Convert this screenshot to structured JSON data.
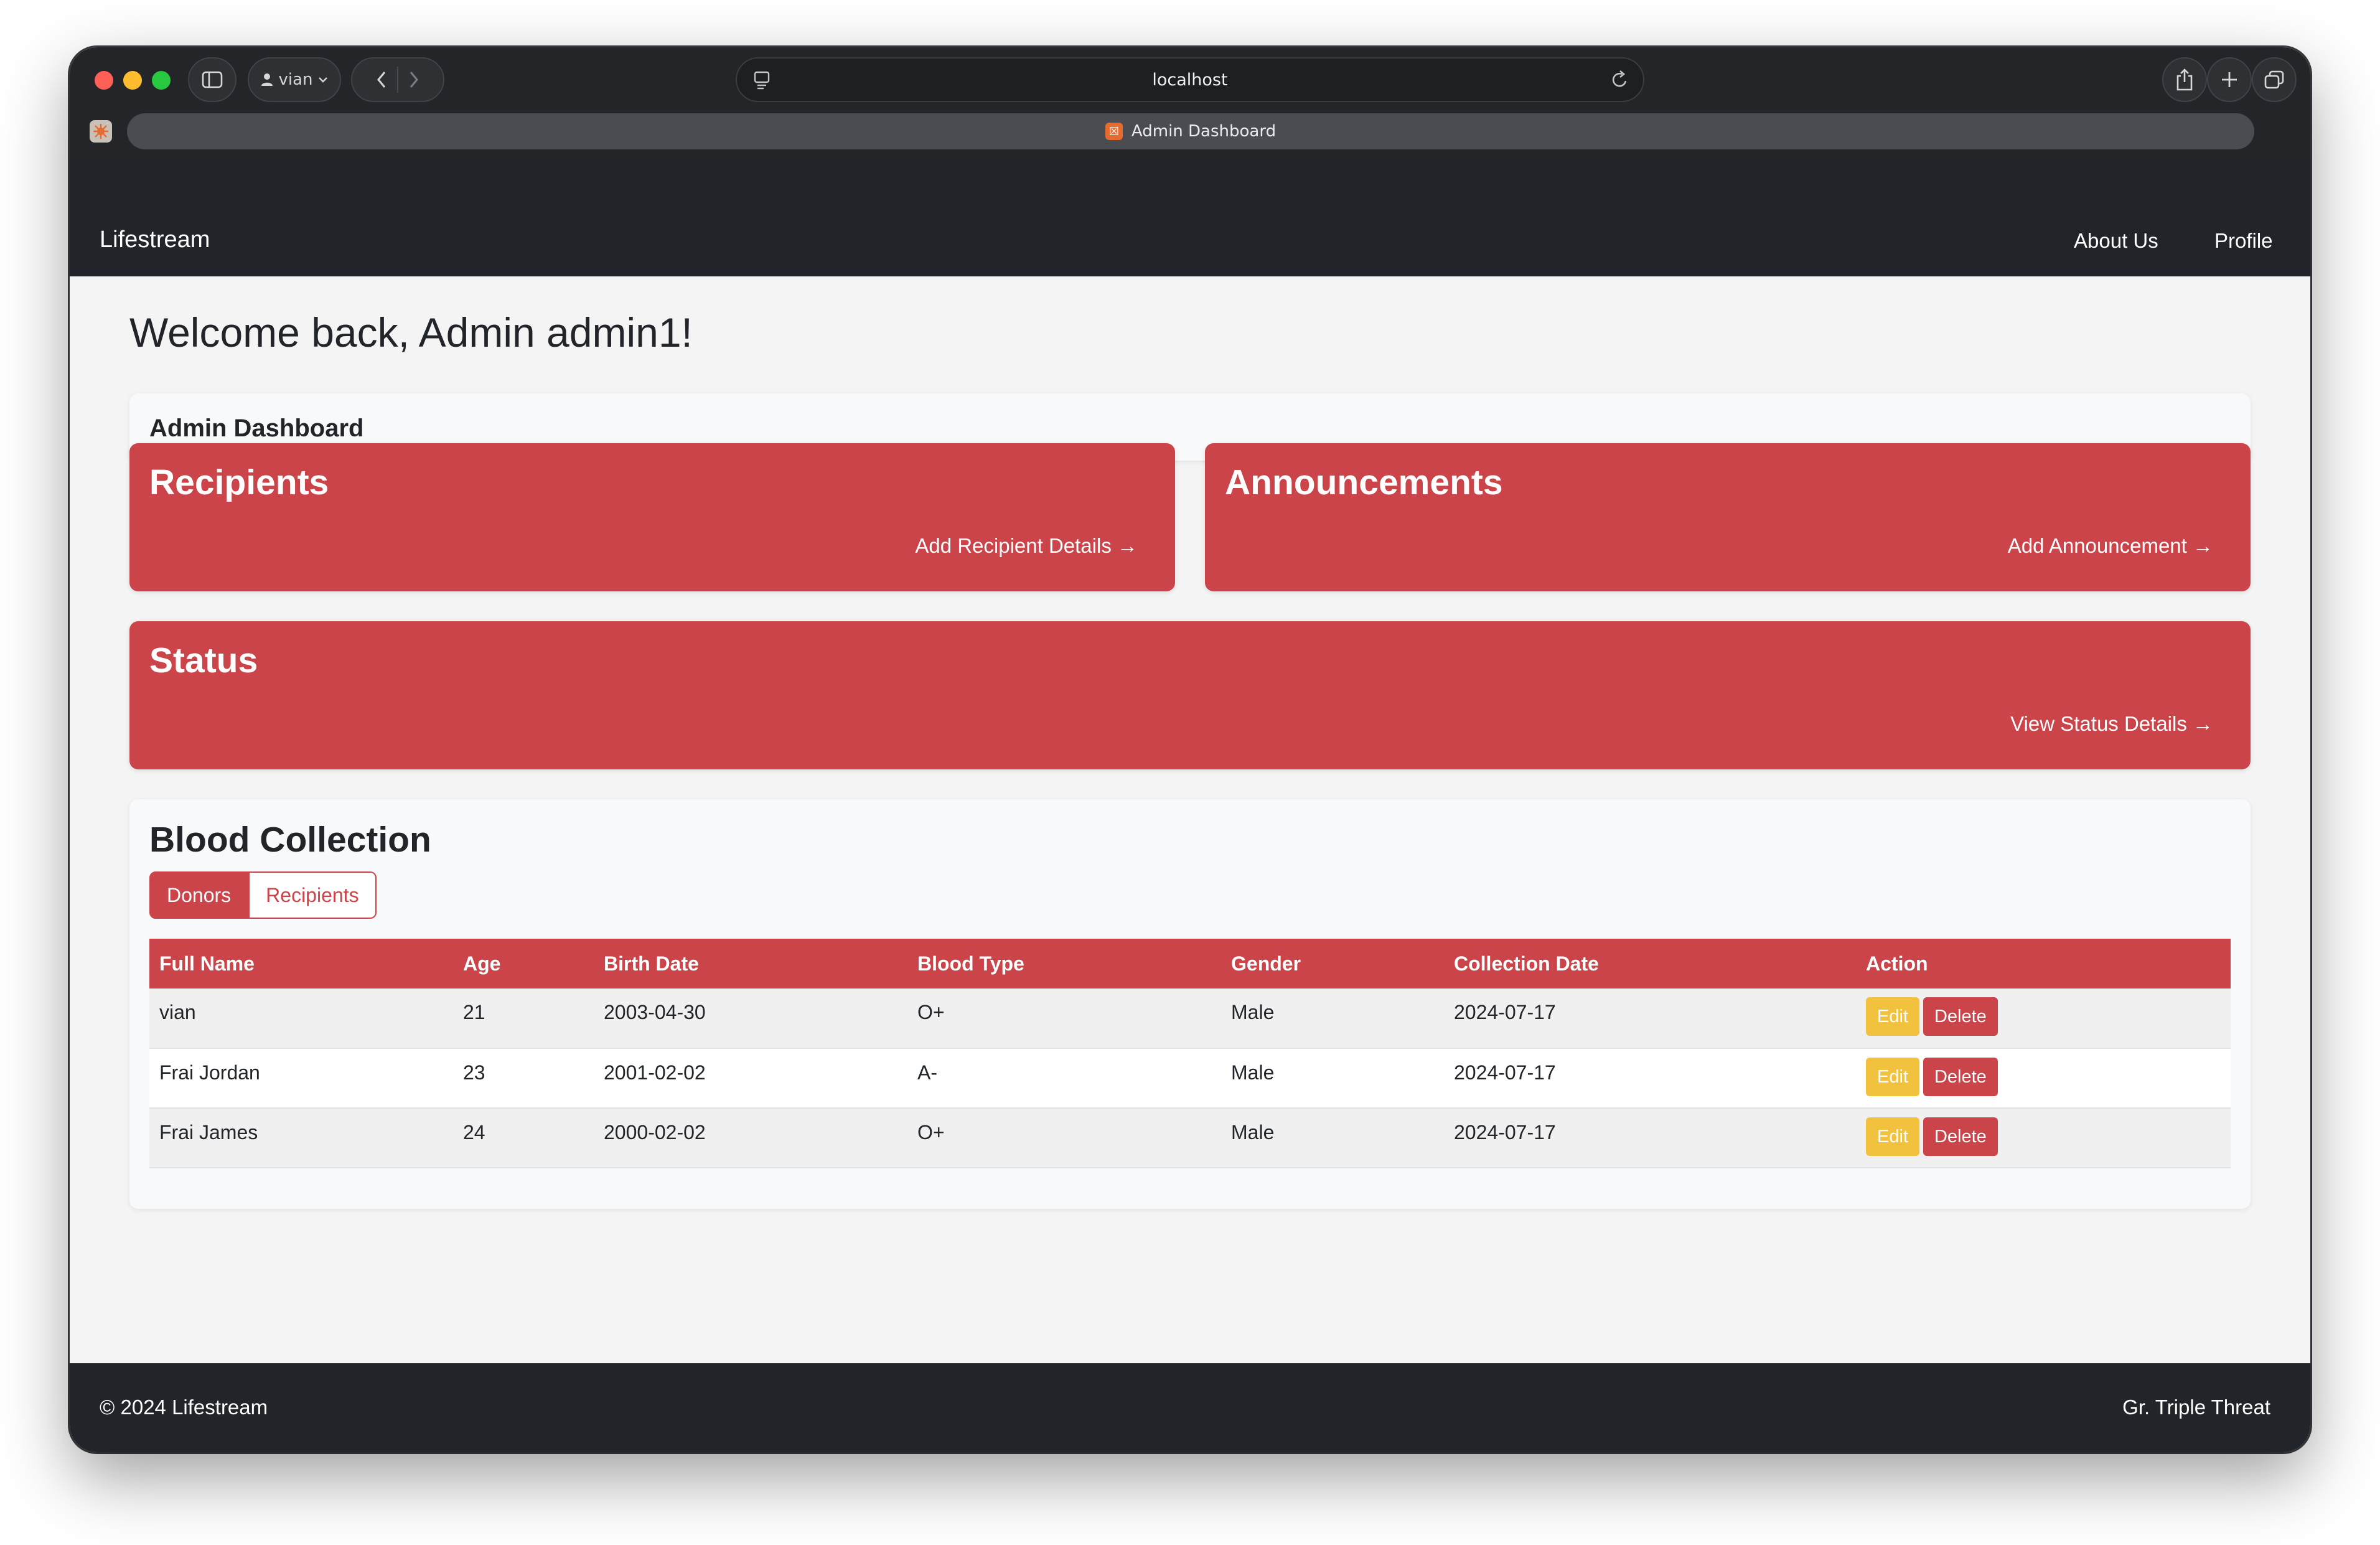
{
  "browser": {
    "profile_name": "vian",
    "address": "localhost",
    "tab_title": "Admin Dashboard"
  },
  "navbar": {
    "brand": "Lifestream",
    "links": [
      "About Us",
      "Profile"
    ]
  },
  "welcome": "Welcome back, Admin admin1!",
  "dashboard_title": "Admin Dashboard",
  "cards": [
    {
      "title": "Recipients",
      "link": "Add Recipient Details →"
    },
    {
      "title": "Announcements",
      "link": "Add Announcement →"
    },
    {
      "title": "Status",
      "link": "View Status Details →"
    }
  ],
  "blood_collection": {
    "title": "Blood Collection",
    "tabs": [
      {
        "label": "Donors",
        "active": true
      },
      {
        "label": "Recipients",
        "active": false
      }
    ],
    "columns": [
      "Full Name",
      "Age",
      "Birth Date",
      "Blood Type",
      "Gender",
      "Collection Date",
      "Action"
    ],
    "rows": [
      {
        "name": "vian",
        "age": "21",
        "birth_date": "2003-04-30",
        "blood_type": "O+",
        "gender": "Male",
        "collection_date": "2024-07-17"
      },
      {
        "name": "Frai Jordan",
        "age": "23",
        "birth_date": "2001-02-02",
        "blood_type": "A-",
        "gender": "Male",
        "collection_date": "2024-07-17"
      },
      {
        "name": "Frai James",
        "age": "24",
        "birth_date": "2000-02-02",
        "blood_type": "O+",
        "gender": "Male",
        "collection_date": "2024-07-17"
      }
    ],
    "actions": {
      "edit": "Edit",
      "delete": "Delete"
    }
  },
  "footer": {
    "copyright": "© 2024 Lifestream",
    "credit": "Gr. Triple Threat"
  },
  "colors": {
    "accent_red": "#cb444a",
    "edit_yellow": "#f2c13d",
    "navbar_dark": "#212429"
  }
}
